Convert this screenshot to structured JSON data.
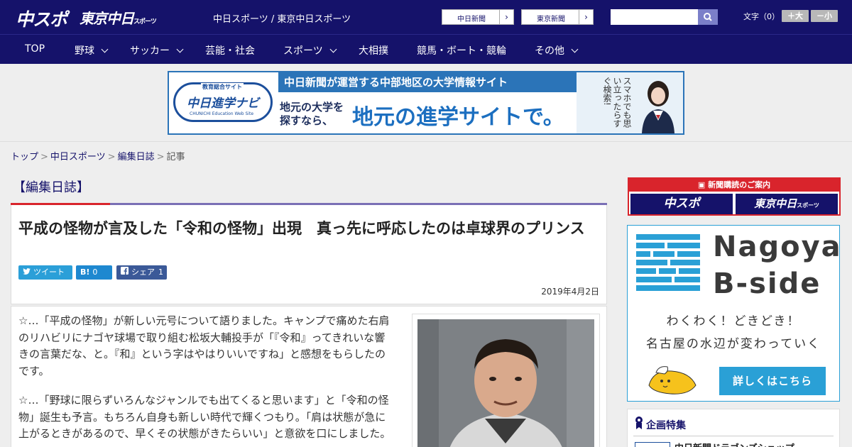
{
  "header": {
    "logo_main": "中スポ",
    "logo_tokyo": "東京中日",
    "logo_tokyo_sub": "スポーツ",
    "tagline": "中日スポーツ / 東京中日スポーツ",
    "link_chunichi": "中日新聞",
    "link_tokyo": "東京新聞",
    "link_arrow": "›",
    "search_placeholder": "",
    "font_label": "文字（0）",
    "font_larger": "＋大",
    "font_smaller": "－小"
  },
  "nav": {
    "items": [
      {
        "label": "TOP"
      },
      {
        "label": "野球"
      },
      {
        "label": "サッカー"
      },
      {
        "label": "芸能・社会"
      },
      {
        "label": "スポーツ"
      },
      {
        "label": "大相撲"
      },
      {
        "label": "競馬・ボート・競輪"
      },
      {
        "label": "その他"
      }
    ]
  },
  "banner": {
    "logo_small": "教育総合サイト",
    "logo_big": "中日進学ナビ",
    "logo_en": "CHUNICHI Education Web Site",
    "headline": "中日新聞が運営する中部地区の大学情報サイト",
    "text1_line1": "地元の大学を",
    "text1_line2": "探すなら、",
    "text2": "地元の進学サイトで。",
    "side_text": "スマホでも思い立ったらすぐ検索!"
  },
  "breadcrumb": {
    "items": [
      "トップ",
      "中日スポーツ",
      "編集日誌"
    ],
    "current": "記事",
    "separator": ">"
  },
  "section": {
    "title": "【編集日誌】"
  },
  "article": {
    "title": "平成の怪物が言及した「令和の怪物」出現　真っ先に呼応したのは卓球界のプリンス",
    "share_twitter": "ツイート",
    "share_hatena": "0",
    "share_hatena_icon": "B!",
    "share_facebook": "シェア",
    "share_facebook_count": "1",
    "date": "2019年4月2日",
    "paragraphs": [
      "☆…「平成の怪物」が新しい元号について語りました。キャンプで痛めた右肩のリハビリにナゴヤ球場で取り組む松坂大輔投手が「『令和』ってきれいな響きの言葉だな、と。『和』という字はやはりいいですね」と感想をもらしたのです。",
      "☆…「野球に限らずいろんなジャンルでも出てくると思います」と「令和の怪物」誕生も予言。もちろん自身も新しい時代で輝くつもり。「肩は状態が急に上がるときがあるので、早くその状態がきたらいい」と意欲を口にしました。"
    ]
  },
  "sidebar": {
    "subscribe_head": "新聞購読のご案内",
    "subscribe_logo1": "中スポ",
    "subscribe_logo2": "東京中日",
    "subscribe_logo2_sub": "スポーツ",
    "nagoya_title_line1": "Nagoya",
    "nagoya_title_line2": "B-side",
    "nagoya_line1": "わくわく！どきどき！",
    "nagoya_line2": "名古屋の水辺が変わっていく",
    "nagoya_button": "詳しくはこちら",
    "kikaku_title": "企画特集",
    "kikaku_item": "中日新聞ドラゴンズショップ"
  },
  "colors": {
    "header_bg": "#15126a",
    "accent_red": "#d9242c",
    "accent_blue": "#2aa0d6",
    "section_rule": "#7a6fb5"
  }
}
